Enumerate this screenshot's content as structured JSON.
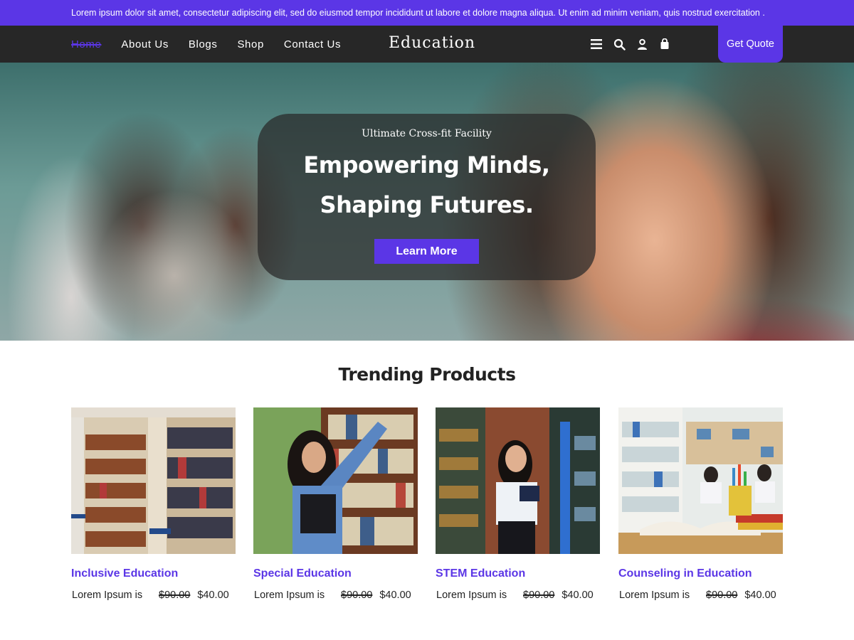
{
  "announcement": "Lorem ipsum dolor sit amet, consectetur adipiscing elit, sed do eiusmod tempor incididunt ut labore et dolore magna aliqua. Ut enim ad minim veniam, quis nostrud exercitation .",
  "nav": {
    "links": [
      "Home",
      "About Us",
      "Blogs",
      "Shop",
      "Contact Us"
    ],
    "active": "Home",
    "logo": "Education",
    "icons": [
      "menu-icon",
      "search-icon",
      "user-icon",
      "bag-icon"
    ],
    "quote_label": "Get Quote"
  },
  "hero": {
    "eyebrow": "Ultimate Cross-fit Facility",
    "title_line1": "Empowering Minds,",
    "title_line2": "Shaping Futures.",
    "button_label": "Learn More"
  },
  "products": {
    "heading": "Trending Products",
    "items": [
      {
        "title": "Inclusive Education",
        "desc": "Lorem Ipsum is",
        "old_price": "$90.00",
        "price": "$40.00"
      },
      {
        "title": "Special Education",
        "desc": "Lorem Ipsum is",
        "old_price": "$90.00",
        "price": "$40.00"
      },
      {
        "title": "STEM Education",
        "desc": "Lorem Ipsum is",
        "old_price": "$90.00",
        "price": "$40.00"
      },
      {
        "title": "Counseling in Education",
        "desc": "Lorem Ipsum is",
        "old_price": "$90.00",
        "price": "$40.00"
      }
    ]
  },
  "colors": {
    "accent": "#5b36e6",
    "navbar": "#272727",
    "text": "#222222"
  }
}
